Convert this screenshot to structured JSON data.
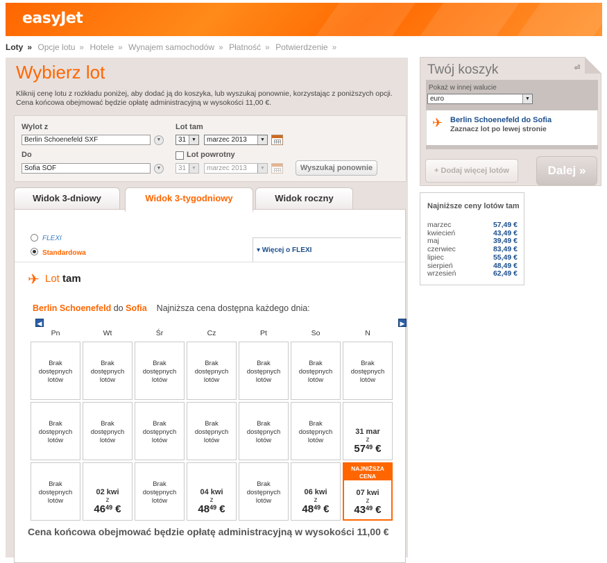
{
  "header": {
    "logo": "easyJet"
  },
  "breadcrumb": [
    "Loty",
    "Opcje lotu",
    "Hotele",
    "Wynajem samochodów",
    "Płatność",
    "Potwierdzenie"
  ],
  "main": {
    "title": "Wybierz lot",
    "intro": "Kliknij cenę lotu z rozkładu poniżej, aby dodać ją do koszyka, lub wyszukaj ponownie, korzystając z poniższych opcji. Cena końcowa obejmować będzie opłatę administracyjną w wysokości 11,00 €."
  },
  "search": {
    "from_label": "Wylot z",
    "from_value": "Berlin Schoenefeld SXF",
    "to_label": "Do",
    "to_value": "Sofia SOF",
    "outbound_label": "Lot tam",
    "outbound_day": "31",
    "outbound_month": "marzec 2013",
    "return_label": "Lot powrotny",
    "return_checked": false,
    "return_day": "31",
    "return_month": "marzec 2013",
    "search_button": "Wyszukaj ponownie"
  },
  "tabs": [
    "Widok 3-dniowy",
    "Widok 3-tygodniowy",
    "Widok roczny"
  ],
  "active_tab": "Widok 3-tygodniowy",
  "fare": {
    "flexi_label": "FLEXI",
    "standard_label": "Standardowa",
    "selected": "Standardowa",
    "more_link": "▾ Więcej o FLEXI"
  },
  "outbound": {
    "heading_prefix": "Lot",
    "heading_bold": "tam",
    "route_from": "Berlin Schoenefeld",
    "route_do": "do",
    "route_to": "Sofia",
    "route_note": "Najniższa cena dostępna każdego dnia:"
  },
  "calendar": {
    "days": [
      "Pn",
      "Wt",
      "Śr",
      "Cz",
      "Pt",
      "So",
      "N"
    ],
    "no_flights_lines": [
      "Brak",
      "dostępnych",
      "lotów"
    ],
    "from_word": "z",
    "lowest_ribbon": "NAJNIŻSZA CENA",
    "rows": [
      [
        {
          "type": "none"
        },
        {
          "type": "none"
        },
        {
          "type": "none"
        },
        {
          "type": "none"
        },
        {
          "type": "none"
        },
        {
          "type": "none"
        },
        {
          "type": "none"
        }
      ],
      [
        {
          "type": "none"
        },
        {
          "type": "none"
        },
        {
          "type": "none"
        },
        {
          "type": "none"
        },
        {
          "type": "none"
        },
        {
          "type": "none"
        },
        {
          "type": "price",
          "date": "31 mar",
          "euros": "57",
          "cents": "49",
          "currency": "€"
        }
      ],
      [
        {
          "type": "none"
        },
        {
          "type": "price",
          "date": "02 kwi",
          "euros": "46",
          "cents": "49",
          "currency": "€"
        },
        {
          "type": "none"
        },
        {
          "type": "price",
          "date": "04 kwi",
          "euros": "48",
          "cents": "49",
          "currency": "€"
        },
        {
          "type": "none"
        },
        {
          "type": "price",
          "date": "06 kwi",
          "euros": "48",
          "cents": "49",
          "currency": "€"
        },
        {
          "type": "price",
          "date": "07 kwi",
          "euros": "43",
          "cents": "49",
          "currency": "€",
          "lowest": true
        }
      ]
    ]
  },
  "final_note": "Cena końcowa obejmować będzie opłatę administracyjną w wysokości 11,00 €",
  "cart": {
    "title": "Twój koszyk",
    "pin_icon": "pin-icon",
    "currency_label": "Pokaż w innej walucie",
    "currency_value": "euro",
    "flight_route": "Berlin Schoenefeld do Sofia",
    "flight_hint": "Zaznacz lot po lewej stronie",
    "add_button": "+ Dodaj więcej lotów",
    "next_button": "Dalej »"
  },
  "lowest_prices": {
    "title": "Najniższe ceny lotów tam",
    "rows": [
      {
        "month": "marzec",
        "price": "57,49 €"
      },
      {
        "month": "kwiecień",
        "price": "43,49 €"
      },
      {
        "month": "maj",
        "price": "39,49 €"
      },
      {
        "month": "czerwiec",
        "price": "83,49 €"
      },
      {
        "month": "lipiec",
        "price": "55,49 €"
      },
      {
        "month": "sierpień",
        "price": "48,49 €"
      },
      {
        "month": "wrzesień",
        "price": "62,49 €"
      }
    ]
  },
  "colors": {
    "brand": "#ff6600",
    "link": "#1b4e8c",
    "panel": "#e8e0dd"
  }
}
